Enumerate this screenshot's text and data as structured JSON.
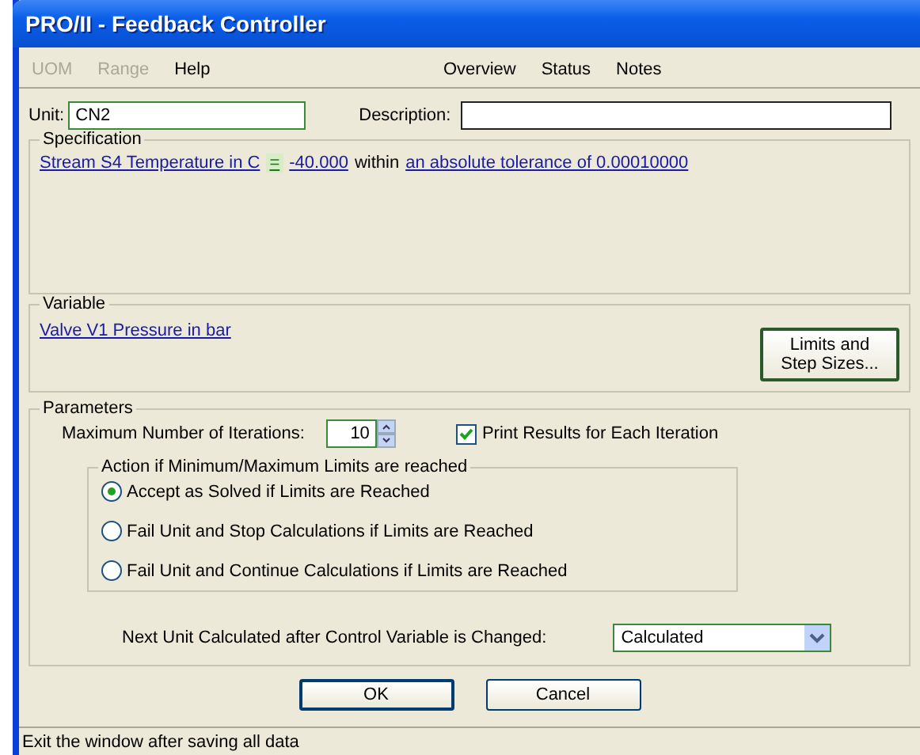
{
  "window": {
    "title": "PRO/II - Feedback Controller"
  },
  "menu": {
    "left": [
      {
        "label": "UOM",
        "disabled": true
      },
      {
        "label": "Range",
        "disabled": true
      },
      {
        "label": "Help",
        "disabled": false
      }
    ],
    "right": [
      {
        "label": "Overview",
        "disabled": false
      },
      {
        "label": "Status",
        "disabled": false
      },
      {
        "label": "Notes",
        "disabled": false
      }
    ]
  },
  "unit": {
    "label": "Unit:",
    "value": "CN2"
  },
  "description": {
    "label": "Description:"
  },
  "specification": {
    "title": "Specification",
    "parts": [
      {
        "kind": "link",
        "text": "Stream S4 Temperature in C"
      },
      {
        "kind": "operator",
        "text": "="
      },
      {
        "kind": "link",
        "text": "-40.000"
      },
      {
        "kind": "text",
        "text": "within"
      },
      {
        "kind": "link",
        "text": "an absolute tolerance of 0.00010000"
      }
    ]
  },
  "variable": {
    "title": "Variable",
    "link": "Valve V1 Pressure in bar",
    "button": [
      "Limits and",
      "Step Sizes..."
    ]
  },
  "parameters": {
    "title": "Parameters",
    "iterations_label": "Maximum Number of Iterations:",
    "iterations": "10",
    "print_results": {
      "label": "Print Results for Each Iteration",
      "checked": true
    },
    "action": {
      "title": "Action if Minimum/Maximum Limits are reached",
      "options": [
        {
          "label": "Accept as Solved if Limits are Reached",
          "selected": true
        },
        {
          "label": "Fail Unit and Stop Calculations if Limits are Reached",
          "selected": false
        },
        {
          "label": "Fail Unit and Continue Calculations if Limits are Reached",
          "selected": false
        }
      ]
    },
    "next_unit_label": "Next Unit Calculated after Control Variable is Changed:",
    "next_unit": "Calculated"
  },
  "buttons": [
    {
      "label": "OK",
      "default": true
    },
    {
      "label": "Cancel",
      "default": false
    }
  ],
  "status_bar": "Exit the window after saving all data"
}
